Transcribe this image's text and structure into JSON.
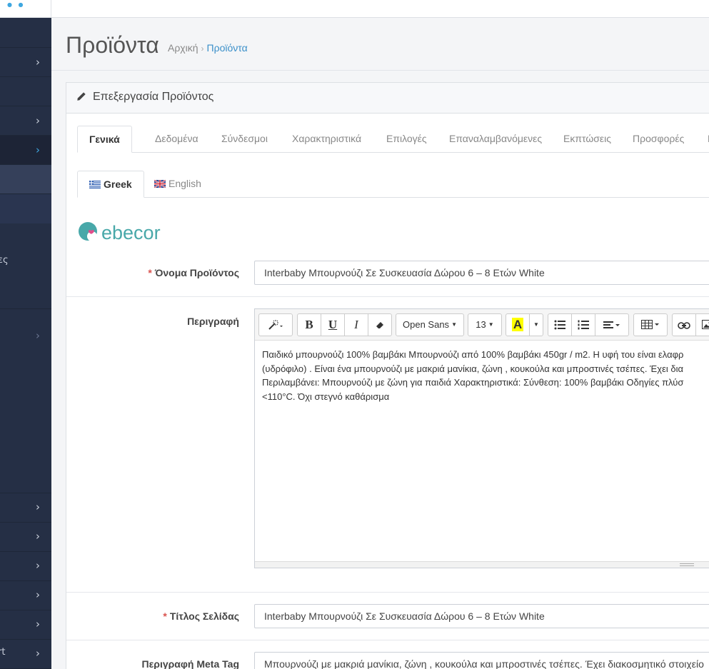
{
  "sidebar": {
    "items": [
      {
        "label": "",
        "chevron": "›"
      },
      {
        "label": "",
        "chevron": ""
      },
      {
        "label": "",
        "chevron": "›"
      },
      {
        "label": "",
        "chevron": "›"
      },
      {
        "label": "",
        "chevron": ""
      },
      {
        "label": "",
        "chevron": ""
      },
      {
        "label": "ες",
        "chevron": ""
      },
      {
        "label": "",
        "chevron": "›"
      },
      {
        "label": "",
        "chevron": "›"
      },
      {
        "label": "",
        "chevron": "›"
      },
      {
        "label": "",
        "chevron": "›"
      },
      {
        "label": "",
        "chevron": "›"
      },
      {
        "label": "",
        "chevron": "›"
      },
      {
        "label": "rt",
        "chevron": "›"
      }
    ]
  },
  "header": {
    "title": "Προϊόντα",
    "breadcrumb": {
      "home": "Αρχική",
      "separator": "›",
      "current": "Προϊόντα"
    }
  },
  "panel": {
    "heading": "Επεξεργασία Προϊόντος",
    "tabs": [
      "Γενικά",
      "Δεδομένα",
      "Σύνδεσμοι",
      "Χαρακτηριστικά",
      "Επιλογές",
      "Επαναλαμβανόμενες",
      "Εκπτώσεις",
      "Προσφορές",
      "Εικ"
    ],
    "language_tabs": [
      "Greek",
      "English"
    ],
    "brand_logo_text": "ebecor"
  },
  "form": {
    "product_name": {
      "label": "Όνομα Προϊόντος",
      "required_mark": "*",
      "value": "Interbaby Μπουρνούζι Σε Συσκευασία Δώρου 6 – 8 Ετών White"
    },
    "description": {
      "label": "Περιγραφή",
      "lines": [
        "Παιδικό μπουρνούζι 100% βαμβάκι Μπουρνούζι από 100% βαμβάκι 450gr / m2. Η υφή του είναι ελαφρ",
        "(υδρόφιλο) . Είναι ένα μπουρνούζι με μακριά μανίκια, ζώνη , κουκούλα και μπροστινές τσέπες. Έχει δια",
        "Περιλαμβάνει: Μπουρνούζι με ζώνη για παιδιά Χαρακτηριστικά: Σύνθεση: 100% βαμβάκι Οδηγίες πλύσ",
        "<110°C. Όχι στεγνό καθάρισμα"
      ]
    },
    "page_title": {
      "label": "Τίτλος Σελίδας",
      "required_mark": "*",
      "value": "Interbaby Μπουρνούζι Σε Συσκευασία Δώρου 6 – 8 Ετών White"
    },
    "meta_description": {
      "label": "Περιγραφή Meta Tag",
      "value": "Μπουρνούζι με μακριά μανίκια, ζώνη , κουκούλα και μπροστινές τσέπες. Έχει διακοσμητικό στοιχείο"
    }
  },
  "editor_toolbar": {
    "bold": "B",
    "underline": "U",
    "italic": "I",
    "font_family": "Open Sans",
    "font_size": "13",
    "color": "A",
    "color_highlight": "#ffff00"
  },
  "colors": {
    "sidebar_bg": "#252f45",
    "accent": "#3a8fc9",
    "required": "#d9534f"
  }
}
